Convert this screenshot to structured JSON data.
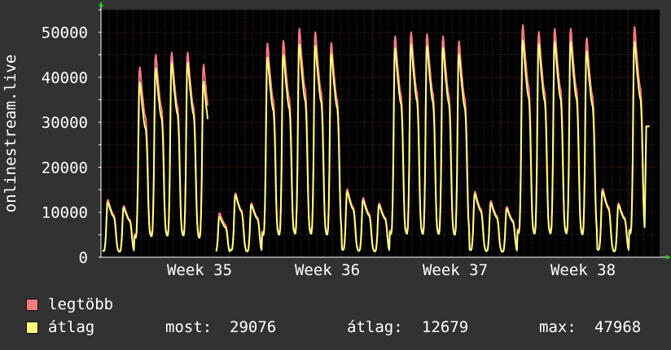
{
  "chart_data": {
    "type": "area",
    "ylabel": "onlinestream.live",
    "ylim": [
      0,
      55000
    ],
    "yticks": [
      0,
      10000,
      20000,
      30000,
      40000,
      50000
    ],
    "x_ticks": [
      "Week 35",
      "Week 36",
      "Week 37",
      "Week 38"
    ],
    "grid": true,
    "day_samples": [
      1300,
      1200,
      1200,
      1500,
      2600,
      4500,
      7800,
      10500,
      10800,
      10500,
      10000,
      9600,
      9200,
      8900,
      8500,
      8200,
      8000,
      7900,
      7400,
      6400,
      4800,
      3100,
      2000,
      1500
    ],
    "series": [
      {
        "name": "legtöbb",
        "color": "#ff7a7f",
        "daily_peaks": [
          12800,
          11400,
          42200,
          45000,
          45500,
          45500,
          42800,
          9800,
          14200,
          12000,
          47500,
          48100,
          50800,
          50000,
          47600,
          15100,
          13200,
          12000,
          49100,
          50000,
          49600,
          49100,
          48000,
          14600,
          12500,
          11200,
          51600,
          50100,
          50800,
          50800,
          48700,
          15200,
          12000,
          51200
        ]
      },
      {
        "name": "átlag",
        "color": "#ffff7f",
        "daily_peaks": [
          12200,
          11000,
          38800,
          42000,
          43200,
          43300,
          39000,
          9000,
          13800,
          11600,
          44400,
          45000,
          47300,
          47000,
          45200,
          14500,
          12600,
          11600,
          46400,
          47300,
          46900,
          46500,
          45100,
          14000,
          12000,
          10800,
          48200,
          47400,
          47900,
          47900,
          45800,
          14700,
          11600,
          47900
        ]
      }
    ],
    "gaps": [
      6.6
    ],
    "tail_value": 29076
  },
  "legend": {
    "items": [
      {
        "label": "legtöbb",
        "color": "#ff7a7f"
      },
      {
        "label": "átlag",
        "color": "#ffff7f"
      }
    ],
    "stats": {
      "now_label": "most:",
      "now_value": "29076",
      "avg_label": "átlag:",
      "avg_value": "12679",
      "max_label": "max:",
      "max_value": "47968"
    }
  }
}
